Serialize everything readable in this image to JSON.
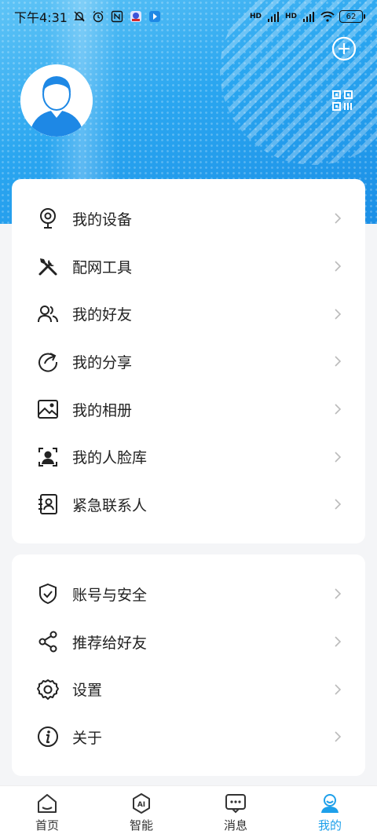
{
  "status_bar": {
    "time": "下午4:31",
    "hd1": "HD",
    "hd2": "HD",
    "battery": "62"
  },
  "header": {
    "add_icon": "plus-circle-icon",
    "qr_icon": "qr-code-icon",
    "avatar_icon": "user-avatar"
  },
  "menu_group1": [
    {
      "label": "我的设备",
      "icon": "camera-icon"
    },
    {
      "label": "配网工具",
      "icon": "tools-icon"
    },
    {
      "label": "我的好友",
      "icon": "friends-icon"
    },
    {
      "label": "我的分享",
      "icon": "share-circle-icon"
    },
    {
      "label": "我的相册",
      "icon": "album-icon"
    },
    {
      "label": "我的人脸库",
      "icon": "face-icon"
    },
    {
      "label": "紧急联系人",
      "icon": "contact-book-icon"
    }
  ],
  "menu_group2": [
    {
      "label": "账号与安全",
      "icon": "shield-icon"
    },
    {
      "label": "推荐给好友",
      "icon": "share-icon"
    },
    {
      "label": "设置",
      "icon": "gear-icon"
    },
    {
      "label": "关于",
      "icon": "info-icon"
    }
  ],
  "bottom_nav": [
    {
      "label": "首页",
      "icon": "home-icon",
      "active": false
    },
    {
      "label": "智能",
      "icon": "ai-icon",
      "active": false
    },
    {
      "label": "消息",
      "icon": "message-icon",
      "active": false
    },
    {
      "label": "我的",
      "icon": "profile-icon",
      "active": true
    }
  ],
  "colors": {
    "accent": "#1ea0ea",
    "header_gradient_start": "#5fc4f6",
    "header_gradient_end": "#1b8fe6"
  }
}
